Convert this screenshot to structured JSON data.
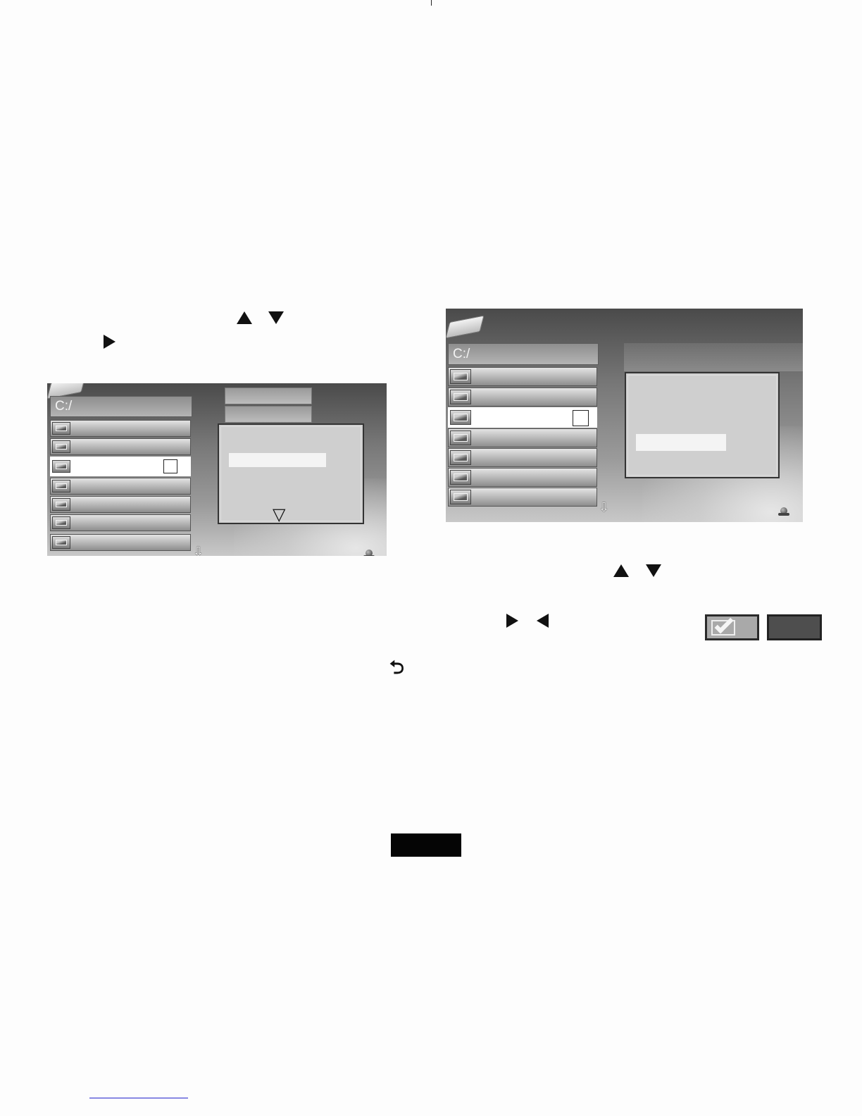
{
  "screens": {
    "left": {
      "path": "C:/",
      "rows": [
        "",
        "",
        "",
        "",
        "",
        "",
        ""
      ],
      "selected_row_index": 2,
      "popup_scroll_icon": "triangle-down-outline-icon",
      "scroll_icon": "down-arrow-outline-icon"
    },
    "right": {
      "path": "C:/",
      "rows": [
        "",
        "",
        "",
        "",
        "",
        "",
        ""
      ],
      "selected_row_index": 2,
      "scroll_icon": "down-arrow-outline-icon"
    }
  },
  "icons": {
    "up": "triangle-up-icon",
    "down": "triangle-down-icon",
    "right": "triangle-right-icon",
    "left": "triangle-left-icon",
    "return": "return-icon",
    "return_glyph": "⮌"
  },
  "dialog_buttons": {
    "ok_icon": "checkmark-icon"
  },
  "colors": {
    "screen_dark": "#4a4a4a",
    "screen_light": "#c8c8c8",
    "selection": "#ffffff",
    "label_black": "#050505",
    "footer_rule": "#2222cc"
  }
}
